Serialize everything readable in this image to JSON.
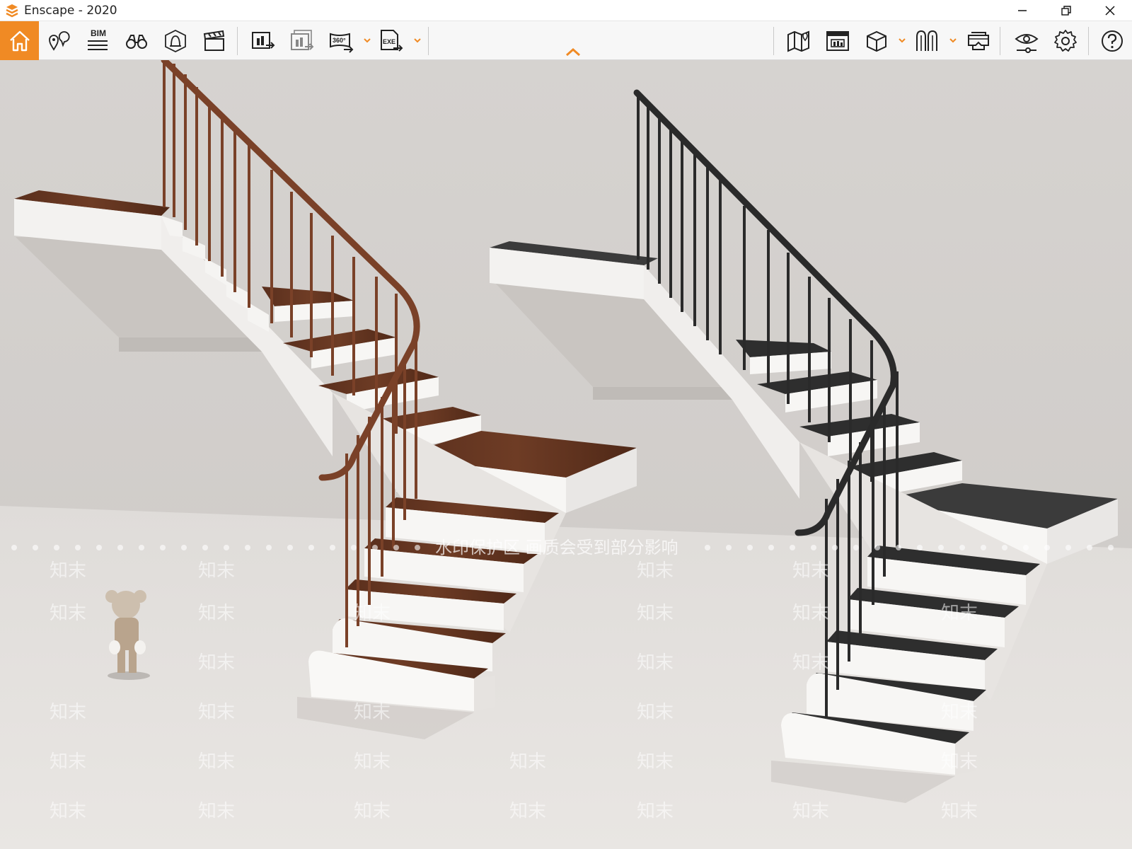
{
  "window": {
    "title": "Enscape - 2020",
    "controls": {
      "minimize": "minimize-icon",
      "restore": "restore-icon",
      "close": "close-icon"
    }
  },
  "toolbar": {
    "bim_label": "BIM",
    "icon_360_label": "360°",
    "icon_exe_label": "EXE",
    "accent_color": "#f08a24",
    "left_tools": [
      "home-icon",
      "location-pins-icon",
      "bim-icon",
      "binoculars-icon",
      "navigation-bell-icon",
      "clapperboard-icon",
      "screenshot-export-icon",
      "batch-render-icon",
      "panorama-360-icon",
      "exe-export-icon"
    ],
    "right_tools": [
      "map-icon",
      "render-window-icon",
      "cube-icon",
      "asset-library-icon",
      "vr-headset-icon",
      "visual-settings-icon",
      "settings-gear-icon",
      "help-icon"
    ]
  },
  "viewport": {
    "watermark_banner": "水印保护区  画质会受到部分影响",
    "watermark_text": "知末",
    "scene": "two-staircases-wood-and-black"
  }
}
